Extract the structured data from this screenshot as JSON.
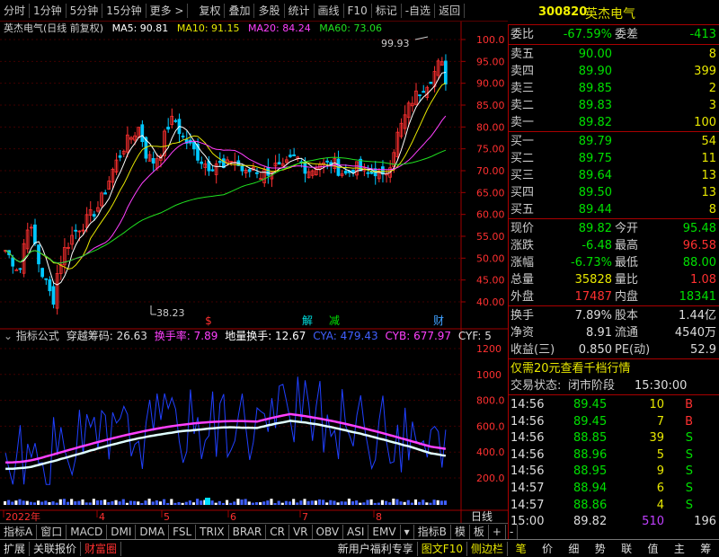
{
  "toolbar": {
    "period_tabs": [
      "分时",
      "1分钟",
      "5分钟",
      "15分钟",
      "更多 >"
    ],
    "tools": [
      "复权",
      "叠加",
      "多股",
      "统计",
      "画线",
      "F10",
      "标记",
      "-自选",
      "返回"
    ]
  },
  "stock": {
    "code": "300820",
    "name": "英杰电气"
  },
  "chart_info": {
    "title": "英杰电气(日线 前复权)",
    "ma5": "MA5: 90.81",
    "ma10": "MA10: 91.15",
    "ma20": "MA20: 84.24",
    "ma60": "MA60: 73.06"
  },
  "price_axis": [
    "100.0",
    "95.00",
    "90.00",
    "85.00",
    "80.00",
    "75.00",
    "70.00",
    "65.00",
    "60.00",
    "55.00",
    "50.00",
    "45.00",
    "40.00"
  ],
  "annotations": {
    "high": "99.93",
    "low": "38.23",
    "markers": [
      "$",
      "解",
      "减",
      "财"
    ]
  },
  "indicator": {
    "label": "指标公式",
    "name": "穿越筹码: 26.63",
    "hsl": "换手率: 7.89",
    "dlhs": "地量换手: 12.67",
    "cya": "CYA: 479.43",
    "cyb": "CYB: 677.97",
    "cyf": "CYF: 5",
    "axis": [
      "1200",
      "1000",
      "800.0",
      "600.0",
      "400.0",
      "200.0"
    ]
  },
  "date_axis": {
    "labels": [
      "2022年",
      "4",
      "5",
      "6",
      "7",
      "8"
    ],
    "period": "日线"
  },
  "bottom_tabs": [
    "指标A",
    "窗口",
    "MACD",
    "DMI",
    "DMA",
    "FSL",
    "TRIX",
    "BRAR",
    "CR",
    "VR",
    "OBV",
    "ASI",
    "EMV",
    "▾",
    "指标B",
    "模",
    "板",
    "+",
    "-"
  ],
  "footer": {
    "left": [
      "扩展",
      "关联报价",
      "财富圈"
    ],
    "ad": "新用户福利专享",
    "f10": "图文F10",
    "side": "侧边栏",
    "right": [
      "笔",
      "价",
      "细",
      "势",
      "联",
      "值",
      "主",
      "筹"
    ]
  },
  "quote": {
    "wb": {
      "label": "委比",
      "value": "-67.59%",
      "label2": "委差",
      "value2": "-413"
    },
    "sells": [
      {
        "label": "卖五",
        "price": "90.00",
        "vol": "8"
      },
      {
        "label": "卖四",
        "price": "89.90",
        "vol": "399"
      },
      {
        "label": "卖三",
        "price": "89.85",
        "vol": "2"
      },
      {
        "label": "卖二",
        "price": "89.83",
        "vol": "3"
      },
      {
        "label": "卖一",
        "price": "89.82",
        "vol": "100"
      }
    ],
    "buys": [
      {
        "label": "买一",
        "price": "89.79",
        "vol": "54"
      },
      {
        "label": "买二",
        "price": "89.75",
        "vol": "11"
      },
      {
        "label": "买三",
        "price": "89.64",
        "vol": "13"
      },
      {
        "label": "买四",
        "price": "89.50",
        "vol": "13"
      },
      {
        "label": "买五",
        "price": "89.44",
        "vol": "8"
      }
    ],
    "stats": [
      {
        "l1": "现价",
        "v1": "89.82",
        "l2": "今开",
        "v2": "95.48"
      },
      {
        "l1": "涨跌",
        "v1": "-6.48",
        "l2": "最高",
        "v2": "96.58"
      },
      {
        "l1": "涨幅",
        "v1": "-6.73%",
        "l2": "最低",
        "v2": "88.00"
      },
      {
        "l1": "总量",
        "v1": "35828",
        "l2": "量比",
        "v2": "1.08"
      },
      {
        "l1": "外盘",
        "v1": "17487",
        "l2": "内盘",
        "v2": "18341"
      }
    ],
    "stats2": [
      {
        "l1": "换手",
        "v1": "7.89%",
        "l2": "股本",
        "v2": "1.44亿"
      },
      {
        "l1": "净资",
        "v1": "8.91",
        "l2": "流通",
        "v2": "4540万"
      },
      {
        "l1": "收益(三)",
        "v1": "0.850",
        "l2": "PE(动)",
        "v2": "52.9"
      }
    ],
    "promo": "仅需20元查看千档行情",
    "status": {
      "label": "交易状态:",
      "value": "闭市阶段",
      "time": "15:30:00"
    },
    "trades": [
      {
        "t": "14:56",
        "p": "89.45",
        "v": "10",
        "d": "B"
      },
      {
        "t": "14:56",
        "p": "89.45",
        "v": "7",
        "d": "B"
      },
      {
        "t": "14:56",
        "p": "88.85",
        "v": "39",
        "d": "S"
      },
      {
        "t": "14:56",
        "p": "88.96",
        "v": "5",
        "d": "S"
      },
      {
        "t": "14:56",
        "p": "88.95",
        "v": "9",
        "d": "S"
      },
      {
        "t": "14:57",
        "p": "88.94",
        "v": "6",
        "d": "S"
      },
      {
        "t": "14:57",
        "p": "88.86",
        "v": "4",
        "d": "S"
      },
      {
        "t": "15:00",
        "p": "89.82",
        "v": "510",
        "d": "196"
      }
    ]
  },
  "colors": {
    "up": "#ff3030",
    "down": "#00e000",
    "yellow": "#e8e800",
    "border": "#a00000"
  }
}
